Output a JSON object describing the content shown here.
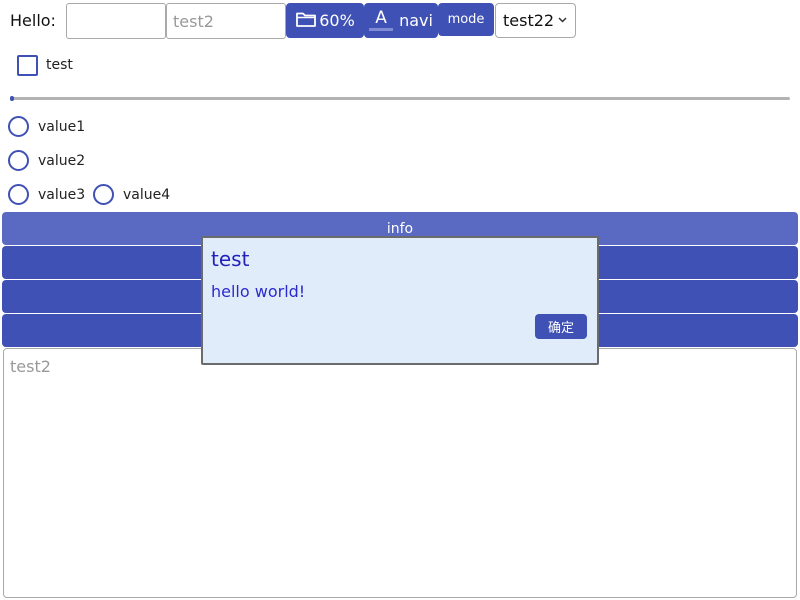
{
  "toolbar": {
    "hello_label": "Hello:",
    "input1_value": "",
    "input2_placeholder": "test2",
    "folder_button_label": "60%",
    "navi_button_icon_letter": "A",
    "navi_button_label": "navi",
    "mode_button_label": "mode",
    "select_value": "test22"
  },
  "checkbox": {
    "label": "test",
    "checked": false
  },
  "slider": {
    "value_fraction": 0.005
  },
  "radios": [
    {
      "label": "value1",
      "checked": false
    },
    {
      "label": "value2",
      "checked": false
    },
    {
      "label": "value3",
      "checked": false
    },
    {
      "label": "value4",
      "checked": false
    }
  ],
  "info_bar": {
    "label": "info"
  },
  "textarea": {
    "placeholder": "test2"
  },
  "dialog": {
    "title": "test",
    "message": "hello world!",
    "ok_label": "确定"
  },
  "icons": {
    "folder": "folder-icon",
    "navi": "text-format-icon",
    "select": "chevron-down-icon"
  },
  "colors": {
    "accent": "#3f51b5",
    "info_bar": "#5a6ac3",
    "dialog_bg": "#e1ecfb",
    "dialog_text": "#2222bb"
  }
}
